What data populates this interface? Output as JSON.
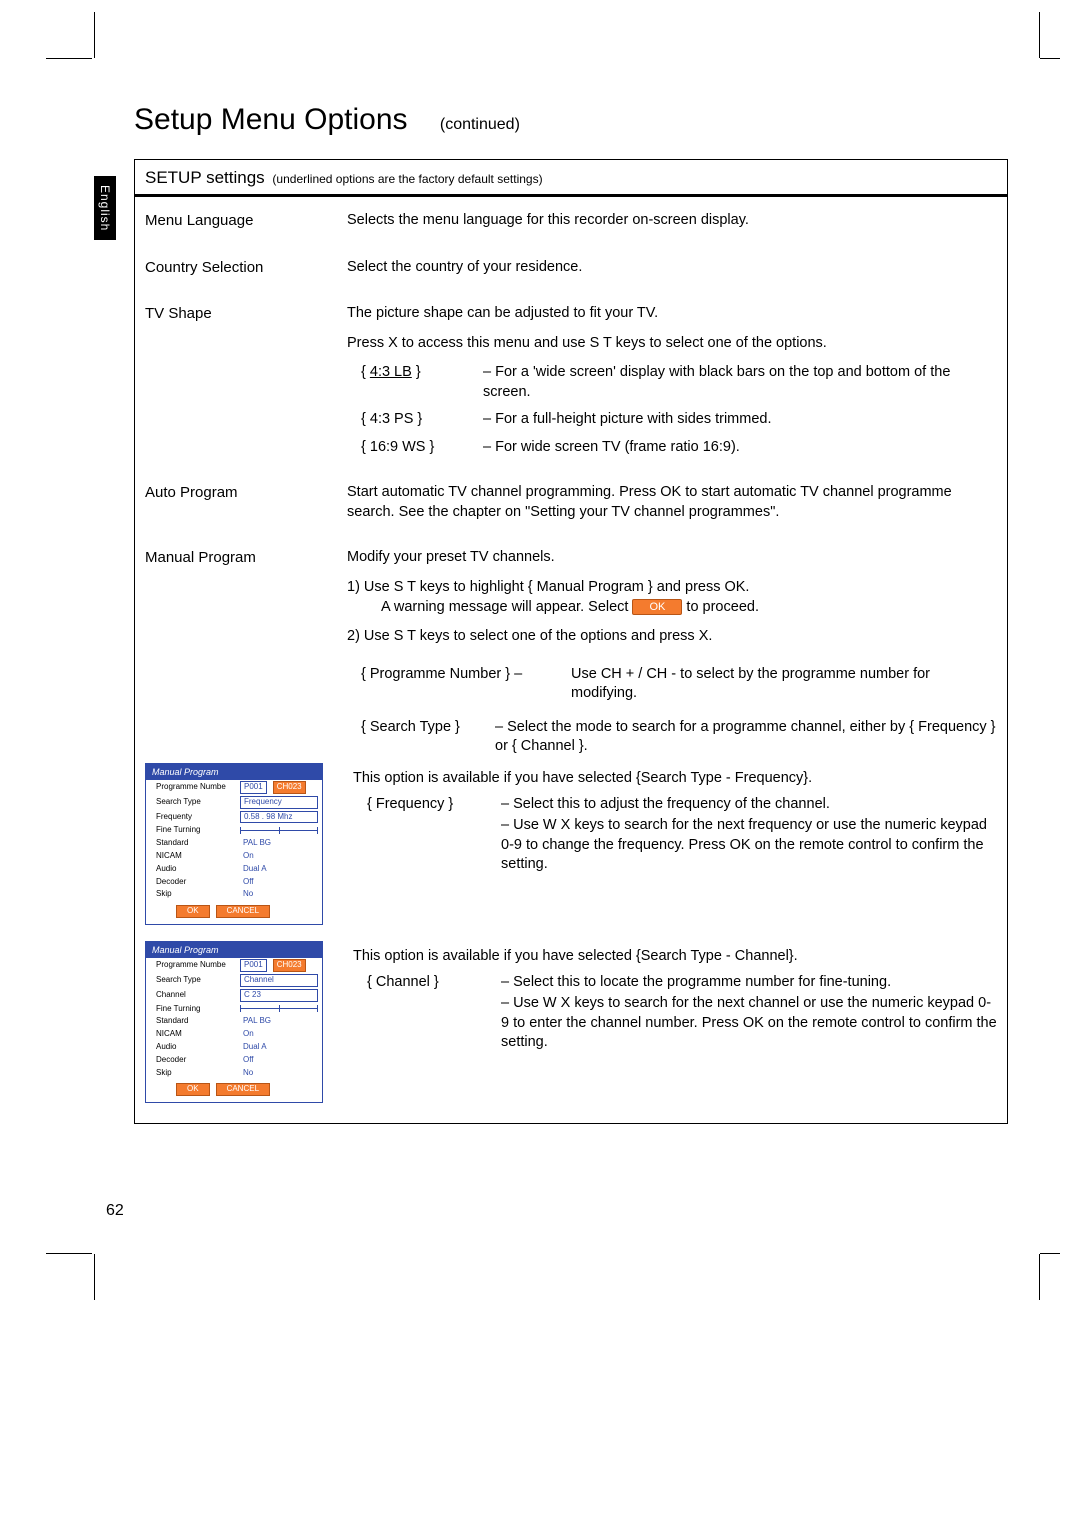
{
  "language_tab": "English",
  "page_number": "62",
  "page_title": "Setup Menu Options",
  "page_title_sub": "(continued)",
  "panel": {
    "header_main": "SETUP settings",
    "header_small": " (underlined options are the factory default settings)"
  },
  "rows": {
    "menu_language": {
      "label": "Menu Language",
      "desc": "Selects the menu language for this recorder on-screen display."
    },
    "country_selection": {
      "label": "Country Selection",
      "desc": "Select the country of your residence."
    },
    "tv_shape": {
      "label": "TV Shape",
      "desc1": "The picture shape can be adjusted to fit your TV.",
      "desc2": "Press  X to access this menu and use  S T keys to select one of the options.",
      "options": {
        "lb": {
          "key": "4:3 LB",
          "desc": "For a 'wide screen' display with black bars on the top and bottom of the screen."
        },
        "ps": {
          "key": "4:3 PS",
          "desc": "For a full-height picture with sides trimmed."
        },
        "ws": {
          "key": "16:9 WS",
          "desc": "For wide screen TV (frame ratio 16:9)."
        }
      }
    },
    "auto_program": {
      "label": "Auto Program",
      "desc": "Start automatic TV channel programming. Press OK to start automatic TV channel programme search. See the chapter on \"Setting your TV channel programmes\"."
    },
    "manual_program": {
      "label": "Manual Program",
      "desc": "Modify your preset TV channels.",
      "step1_a": "1)  Use  S T keys to highlight  {",
      "step1_key": " Manual Program ",
      "step1_b": " } and press OK.",
      "step1_c": "A warning message will appear. Select ",
      "step1_d": " to proceed.",
      "ok_btn": "OK",
      "step2": "2)  Use  S T keys to select one of the options and press  X.",
      "opts": {
        "prog_num": {
          "key": "{ Programme Number  } –",
          "desc": "  Use CH + / CH -   to select by the programme number for modifying."
        },
        "search_type": {
          "key": "{ Search Type }",
          "desc": "Select the mode to search for a programme channel, either by { Frequency } or { Channel }."
        },
        "frequency": {
          "note": "This option is available if you have selected {Search Type - Frequency}.",
          "key": "{ Frequency }",
          "d1": "Select this to adjust the frequency of the channel.",
          "d2": "Use  W X keys to search for the next frequency or use the numeric keypad 0-9 to change the frequency. Press OK on the remote control to confirm the setting."
        },
        "channel": {
          "note": "This option is available if you have selected {Search Type - Channel}.",
          "key": "{ Channel }",
          "d1": "Select this to locate the programme number for fine-tuning.",
          "d2": "Use  W X keys to search for the next channel or use the numeric keypad 0-9 to enter the channel number. Press OK on the remote control to confirm the setting."
        }
      }
    }
  },
  "osd": {
    "title": "Manual Program",
    "freq": {
      "rows": [
        {
          "k": "Programme Numbe",
          "v1": "P001",
          "v2": "CH023"
        },
        {
          "k": "Search Type",
          "v": "Frequency"
        },
        {
          "k": "Frequenty",
          "v": "0.58 . 98 Mhz"
        },
        {
          "k": "Fine Turning",
          "slider": true
        },
        {
          "k": "Standard",
          "v": "PAL BG"
        },
        {
          "k": "NICAM",
          "v": "On"
        },
        {
          "k": "Audio",
          "v": "Dual A"
        },
        {
          "k": "Decoder",
          "v": "Off"
        },
        {
          "k": "Skip",
          "v": "No"
        }
      ]
    },
    "chan": {
      "rows": [
        {
          "k": "Programme Numbe",
          "v1": "P001",
          "v2": "CH023"
        },
        {
          "k": "Search Type",
          "v": "Channel"
        },
        {
          "k": "Channel",
          "v": "C 23"
        },
        {
          "k": "Fine Turning",
          "slider": true
        },
        {
          "k": "Standard",
          "v": "PAL BG"
        },
        {
          "k": "NICAM",
          "v": "On"
        },
        {
          "k": "Audio",
          "v": "Dual A"
        },
        {
          "k": "Decoder",
          "v": "Off"
        },
        {
          "k": "Skip",
          "v": "No"
        }
      ]
    },
    "ok": "OK",
    "cancel": "CANCEL"
  }
}
